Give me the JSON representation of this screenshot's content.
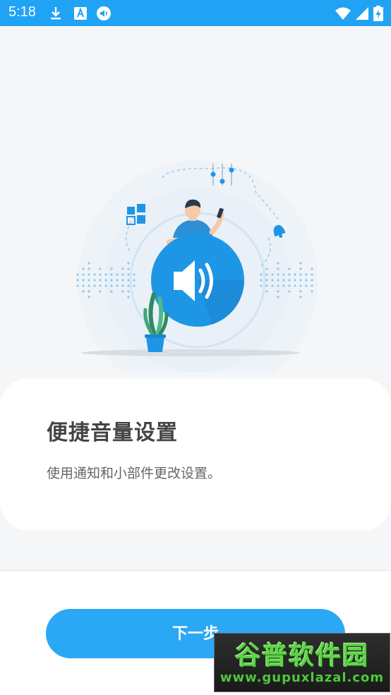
{
  "status_bar": {
    "time": "5:18",
    "left_icons": [
      "download-icon",
      "font-a-icon",
      "volume-badge-icon"
    ],
    "right_icons": [
      "wifi-icon",
      "signal-icon",
      "battery-charging-icon"
    ]
  },
  "card": {
    "title": "便捷音量设置",
    "description": "使用通知和小部件更改设置。"
  },
  "footer": {
    "next_button": "下一步"
  },
  "watermark": {
    "title": "谷普软件园",
    "url": "www.gupuxlazal.com"
  },
  "colors": {
    "status_bar": "#20a3f5",
    "accent": "#2ba8f5",
    "background": "#f5f6f8",
    "card": "#ffffff"
  }
}
